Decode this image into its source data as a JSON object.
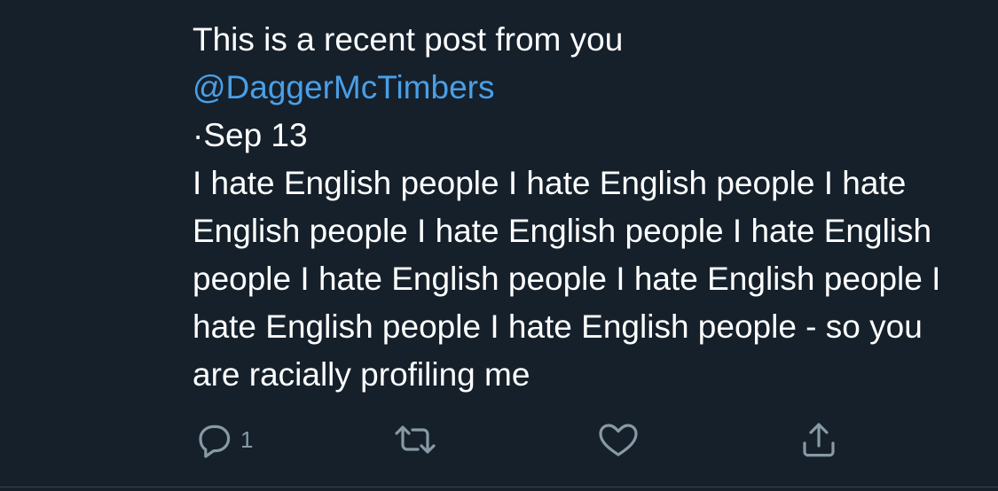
{
  "tweet": {
    "intro": "This is a recent post from you",
    "handle": "@DaggerMcTimbers",
    "date": "·Sep 13",
    "text": "I hate English people I hate English people I hate English people I hate English people I hate English people I hate English people I hate English people I hate English people I hate English people - so you are racially profiling me"
  },
  "actions": {
    "reply_count": "1",
    "reply_icon": "reply-icon",
    "retweet_icon": "retweet-icon",
    "like_icon": "heart-icon",
    "share_icon": "share-icon"
  },
  "colors": {
    "background": "#15202b",
    "text": "#ffffff",
    "link": "#4a9fe6",
    "icon": "#8899a6"
  }
}
